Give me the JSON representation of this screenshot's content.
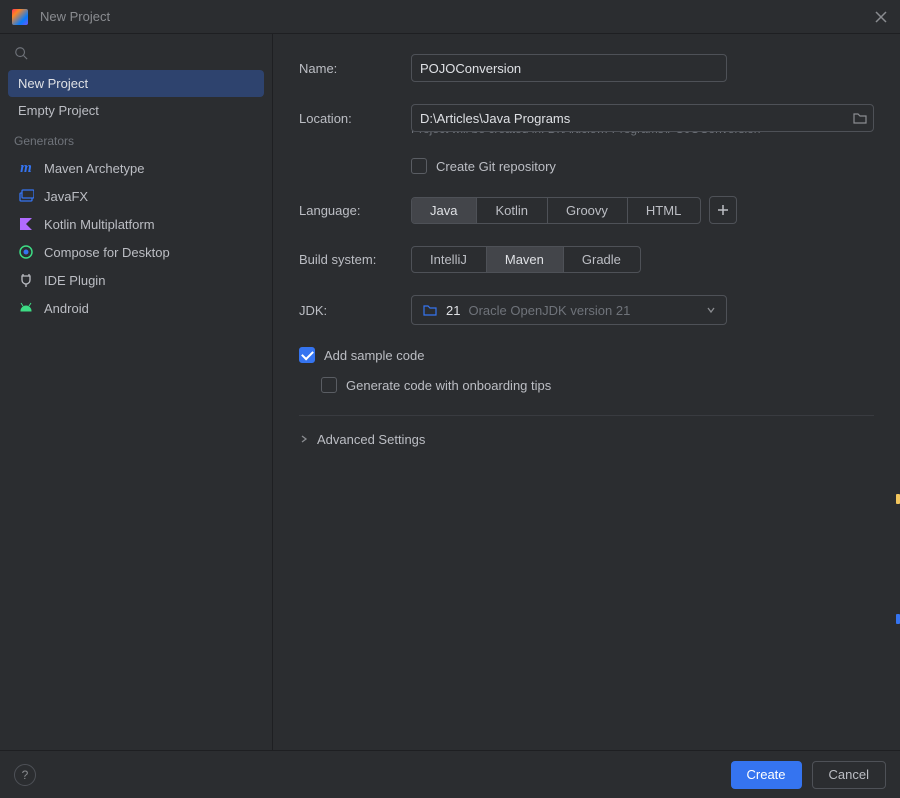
{
  "title": "New Project",
  "sidebar": {
    "items": [
      {
        "label": "New Project"
      },
      {
        "label": "Empty Project"
      }
    ],
    "generators_header": "Generators",
    "generators": [
      {
        "label": "Maven Archetype"
      },
      {
        "label": "JavaFX"
      },
      {
        "label": "Kotlin Multiplatform"
      },
      {
        "label": "Compose for Desktop"
      },
      {
        "label": "IDE Plugin"
      },
      {
        "label": "Android"
      }
    ]
  },
  "form": {
    "name_label": "Name:",
    "name_value": "POJOConversion",
    "location_label": "Location:",
    "location_value": "D:\\Articles\\Java Programs",
    "location_hint": "Project will be created in: D:\\Article… Programs\\POJOConversion",
    "git_repo_label": "Create Git repository",
    "language_label": "Language:",
    "languages": [
      "Java",
      "Kotlin",
      "Groovy",
      "HTML"
    ],
    "build_label": "Build system:",
    "builds": [
      "IntelliJ",
      "Maven",
      "Gradle"
    ],
    "jdk_label": "JDK:",
    "jdk_version": "21",
    "jdk_desc": "Oracle OpenJDK version 21",
    "add_sample_label": "Add sample code",
    "onboarding_label": "Generate code with onboarding tips",
    "advanced_label": "Advanced Settings"
  },
  "footer": {
    "create": "Create",
    "cancel": "Cancel"
  }
}
